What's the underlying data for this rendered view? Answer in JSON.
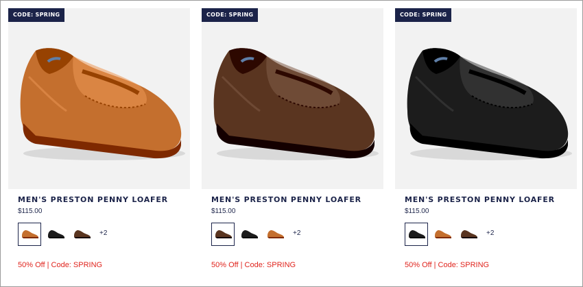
{
  "products": [
    {
      "badge": "CODE: SPRING",
      "title": "MEN'S PRESTON PENNY LOAFER",
      "price": "$115.00",
      "more_colors": "+2",
      "promo": "50% Off | Code: SPRING",
      "shoe_color": "tan",
      "swatches": [
        "tan",
        "black",
        "brown"
      ],
      "selected_swatch": 0
    },
    {
      "badge": "CODE: SPRING",
      "title": "MEN'S PRESTON PENNY LOAFER",
      "price": "$115.00",
      "more_colors": "+2",
      "promo": "50% Off | Code: SPRING",
      "shoe_color": "brown",
      "swatches": [
        "brown",
        "black",
        "tan"
      ],
      "selected_swatch": 0
    },
    {
      "badge": "CODE: SPRING",
      "title": "MEN'S PRESTON PENNY LOAFER",
      "price": "$115.00",
      "more_colors": "+2",
      "promo": "50% Off | Code: SPRING",
      "shoe_color": "black",
      "swatches": [
        "black",
        "tan",
        "brown"
      ],
      "selected_swatch": 0
    }
  ],
  "colors": {
    "tan": "#c46f2e",
    "brown": "#5a3520",
    "black": "#1c1c1c",
    "badge_bg": "#1b2349",
    "promo": "#e0231c",
    "image_bg": "#f2f2f2"
  }
}
